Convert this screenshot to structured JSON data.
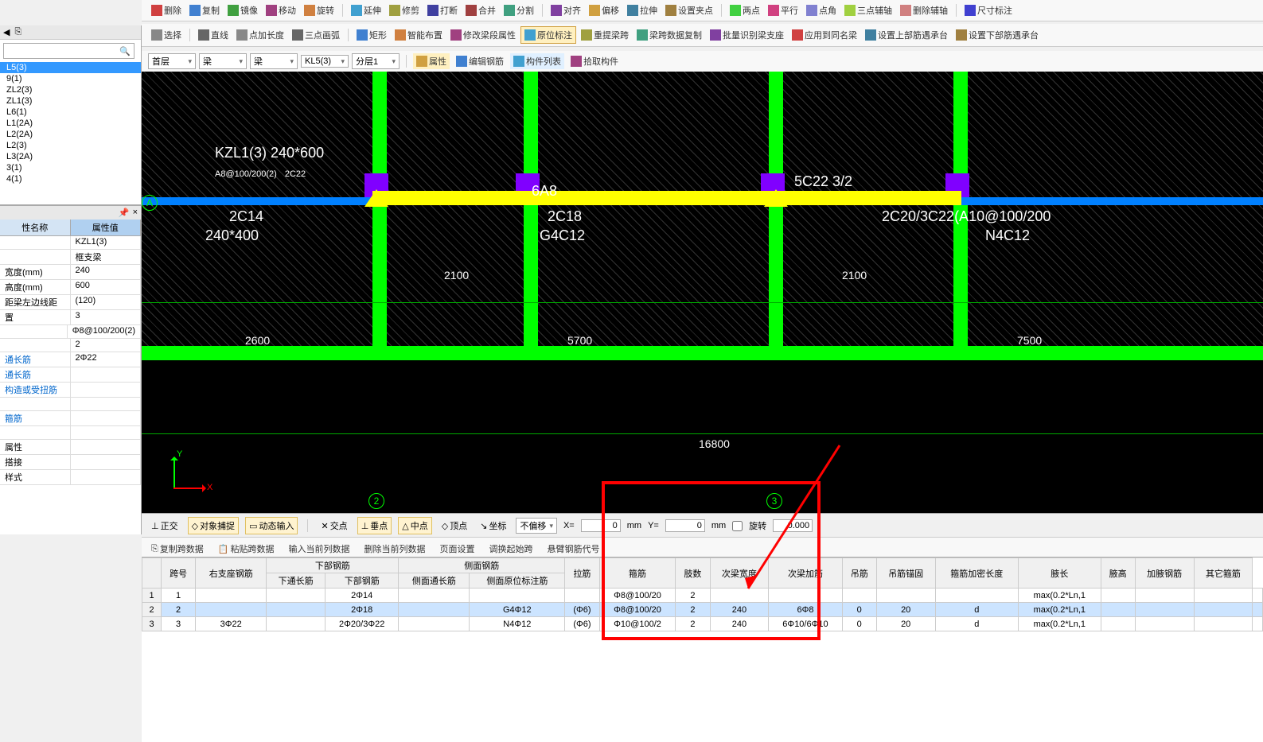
{
  "toolbar1": {
    "items": [
      "删除",
      "复制",
      "镜像",
      "移动",
      "旋转",
      "延伸",
      "修剪",
      "打断",
      "合并",
      "分割",
      "对齐",
      "偏移",
      "拉伸",
      "设置夹点",
      "两点",
      "平行",
      "点角",
      "三点辅轴",
      "删除辅轴",
      "尺寸标注"
    ]
  },
  "toolbar2": {
    "items": [
      "选择",
      "直线",
      "点加长度",
      "三点画弧",
      "矩形",
      "智能布置",
      "修改梁段属性",
      "原位标注",
      "重提梁跨",
      "梁跨数据复制",
      "批量识别梁支座",
      "应用到同名梁",
      "设置上部筋遇承台",
      "设置下部筋遇承台"
    ]
  },
  "dropdowns": {
    "floor": "首层",
    "cat": "梁",
    "sub": "梁",
    "name": "KL5(3)",
    "layer": "分层1"
  },
  "props_toolbar": [
    "属性",
    "编辑钢筋",
    "构件列表",
    "拾取构件"
  ],
  "tree": {
    "items": [
      "L5(3)",
      "9(1)",
      "ZL2(3)",
      "ZL1(3)",
      "L6(1)",
      "L1(2A)",
      "L2(2A)",
      "L2(3)",
      "L3(2A)",
      "3(1)",
      "4(1)"
    ],
    "selected_idx": 0
  },
  "prop_panel": {
    "pin_label": "×",
    "header": [
      "性名称",
      "属性值"
    ],
    "rows": [
      [
        "",
        "KZL1(3)"
      ],
      [
        "",
        "框支梁"
      ],
      [
        "宽度(mm)",
        "240"
      ],
      [
        "高度(mm)",
        "600"
      ],
      [
        "距梁左边线距",
        "(120)"
      ],
      [
        "置",
        "3"
      ],
      [
        "",
        "Φ8@100/200(2)"
      ],
      [
        "",
        "2"
      ],
      [
        "通长筋",
        "2Φ22"
      ],
      [
        "通长筋",
        ""
      ],
      [
        "构造或受扭筋",
        ""
      ],
      [
        "",
        ""
      ],
      [
        "箍筋",
        ""
      ],
      [
        "",
        ""
      ],
      [
        "属性",
        ""
      ],
      [
        "搭接",
        ""
      ],
      [
        "样式",
        ""
      ]
    ]
  },
  "canvas_labels": {
    "l1": "KZL1(3) 240*600",
    "l1b": "A8@100/200(2)",
    "l1c": "2C22",
    "l2": "2C14",
    "l2b": "240*400",
    "l3": "6A8",
    "l4": "2C18",
    "l4b": "G4C12",
    "l5": "5C22 3/2",
    "l6": "2C20/3C22(A10@100/200",
    "l6b": "N4C12",
    "d1": "2100",
    "d2": "2100",
    "d3": "2600",
    "d4": "5700",
    "d5": "7500",
    "d6": "16800",
    "ax_y": "Y",
    "ax_x": "X",
    "bubble2": "2",
    "bubble3": "3",
    "bubbleA": "A"
  },
  "status": {
    "ortho": "正交",
    "snap": "对象捕捉",
    "dyn": "动态输入",
    "cross": "交点",
    "perp": "垂点",
    "mid": "中点",
    "vert": "顶点",
    "coord": "坐标",
    "nooff": "不偏移",
    "x_lbl": "X=",
    "x_val": "0",
    "mm1": "mm",
    "y_lbl": "Y=",
    "y_val": "0",
    "mm2": "mm",
    "rot": "旋转",
    "rot_val": "0.000"
  },
  "bottom_tb": [
    "复制跨数据",
    "粘贴跨数据",
    "输入当前列数据",
    "删除当前列数据",
    "页面设置",
    "调换起始跨",
    "悬臂钢筋代号"
  ],
  "table": {
    "group_headers": [
      "下部钢筋",
      "侧面钢筋"
    ],
    "headers": [
      "跨号",
      "右支座钢筋",
      "下通长筋",
      "下部钢筋",
      "侧面通长筋",
      "侧面原位标注筋",
      "拉筋",
      "箍筋",
      "肢数",
      "次梁宽度",
      "次梁加筋",
      "吊筋",
      "吊筋锚固",
      "箍筋加密长度",
      "腋长",
      "腋高",
      "加腋钢筋",
      "其它箍筋"
    ],
    "rows": [
      {
        "n": "1",
        "sn": "1",
        "r": [
          "",
          "",
          "2Φ14",
          "",
          "",
          "",
          "Φ8@100/20",
          "2",
          "",
          "",
          "",
          "",
          "",
          "max(0.2*Ln,1",
          "",
          "",
          "",
          ""
        ]
      },
      {
        "n": "2",
        "sn": "2",
        "r": [
          "",
          "",
          "2Φ18",
          "",
          "G4Φ12",
          "(Φ6)",
          "Φ8@100/20",
          "2",
          "240",
          "6Φ8",
          "0",
          "20",
          "d",
          "max(0.2*Ln,1",
          "",
          "",
          "",
          ""
        ]
      },
      {
        "n": "3",
        "sn": "3",
        "r": [
          "3Φ22",
          "",
          "2Φ20/3Φ22",
          "",
          "N4Φ12",
          "(Φ6)",
          "Φ10@100/2",
          "2",
          "240",
          "6Φ10/6Φ10",
          "0",
          "20",
          "d",
          "max(0.2*Ln,1",
          "",
          "",
          "",
          ""
        ]
      }
    ],
    "selected_row": 1
  }
}
